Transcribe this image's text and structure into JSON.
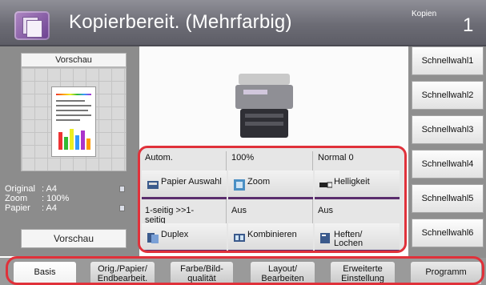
{
  "header": {
    "title": "Kopierbereit. (Mehrfarbig)",
    "copies_label": "Kopien",
    "copies_value": "1"
  },
  "preview": {
    "title": "Vorschau",
    "button_label": "Vorschau",
    "info": [
      {
        "label": "Original",
        "value": ": A4"
      },
      {
        "label": "Zoom",
        "value": ": 100%"
      },
      {
        "label": "Papier",
        "value": ": A4"
      }
    ]
  },
  "functions": [
    {
      "value": "Autom.",
      "label": "Papier Auswahl",
      "icon": "paper-tray-icon"
    },
    {
      "value": "100%",
      "label": "Zoom",
      "icon": "zoom-icon"
    },
    {
      "value": "Normal 0",
      "label": "Helligkeit",
      "icon": "brightness-icon"
    },
    {
      "value": "1-seitig >>1-seitig",
      "label": "Duplex",
      "icon": "duplex-icon"
    },
    {
      "value": "Aus",
      "label": "Kombinieren",
      "icon": "combine-icon"
    },
    {
      "value": "Aus",
      "label": "Heften/ Lochen",
      "icon": "staple-icon"
    }
  ],
  "quick_keys": [
    "Schnellwahl1",
    "Schnellwahl2",
    "Schnellwahl3",
    "Schnellwahl4",
    "Schnellwahl5",
    "Schnellwahl6"
  ],
  "tabs": [
    {
      "label": "Basis",
      "active": true
    },
    {
      "label": "Orig./Papier/ Endbearbeit.",
      "active": false
    },
    {
      "label": "Farbe/Bild- qualität",
      "active": false
    },
    {
      "label": "Layout/ Bearbeiten",
      "active": false
    },
    {
      "label": "Erweiterte Einstellung",
      "active": false
    },
    {
      "label": "Programm",
      "active": false
    }
  ],
  "colors": {
    "highlight": "#e0313a",
    "accent": "#5a2d6d",
    "header": "#6c6c75"
  }
}
